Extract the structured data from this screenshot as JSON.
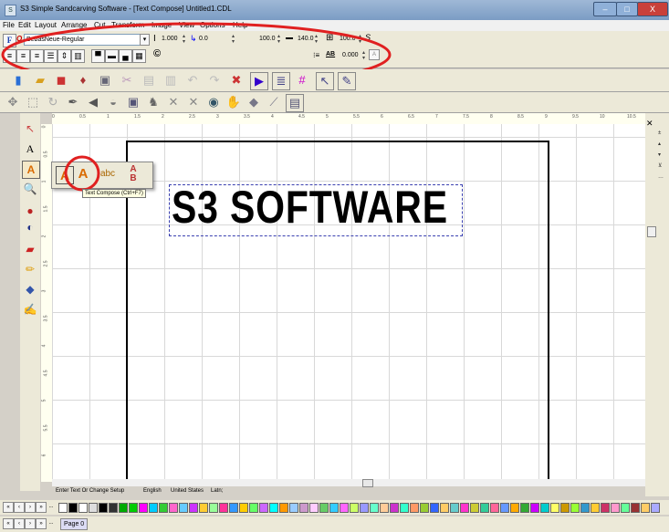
{
  "window": {
    "title": "S3 Simple Sandcarving Software - [Text Compose] Untitled1.CDL",
    "min_label": "–",
    "max_label": "□",
    "close_label": "X"
  },
  "menu": {
    "items": [
      "File",
      "Edit",
      "Layout",
      "Arrange",
      "Cut",
      "Transform",
      "Image",
      "View",
      "Options",
      "Help"
    ]
  },
  "text_toolbar": {
    "font_name": "BebasNeue-Regular",
    "font_size": "1.000",
    "tracking_value": "0.0",
    "height_pct": "100.0",
    "width_pct": "140.0",
    "grid_value": "100.0",
    "kern_value": "0.000",
    "copyright_glyph": "©",
    "ab_label": "AB"
  },
  "canvas": {
    "text": "S3 SOFTWARE"
  },
  "ruler": {
    "h_labels": [
      "0",
      "0.5",
      "1",
      "1.5",
      "2",
      "2.5",
      "3",
      "3.5",
      "4",
      "4.5",
      "5",
      "5.5",
      "6",
      "6.5",
      "7",
      "7.5",
      "8",
      "8.5",
      "9",
      "9.5",
      "10",
      "10.5"
    ],
    "v_labels": [
      "0",
      "0.5",
      "1",
      "1.5",
      "2",
      "2.5",
      "3",
      "3.5",
      "4",
      "4.5",
      "5",
      "5.5",
      "6"
    ]
  },
  "flyout": {
    "tooltip": "Text Compose (Ctrl+F7)"
  },
  "status": {
    "hint": "Enter Text Or Change Setup",
    "language": "English",
    "region": "United States",
    "script": "Latn;"
  },
  "pagebar": {
    "page_label": "Page 0",
    "more_label": "..."
  },
  "colors": {
    "highlight_ring": "#e02020",
    "titlebar": "#7b9cc4",
    "close_button": "#c9403a"
  }
}
